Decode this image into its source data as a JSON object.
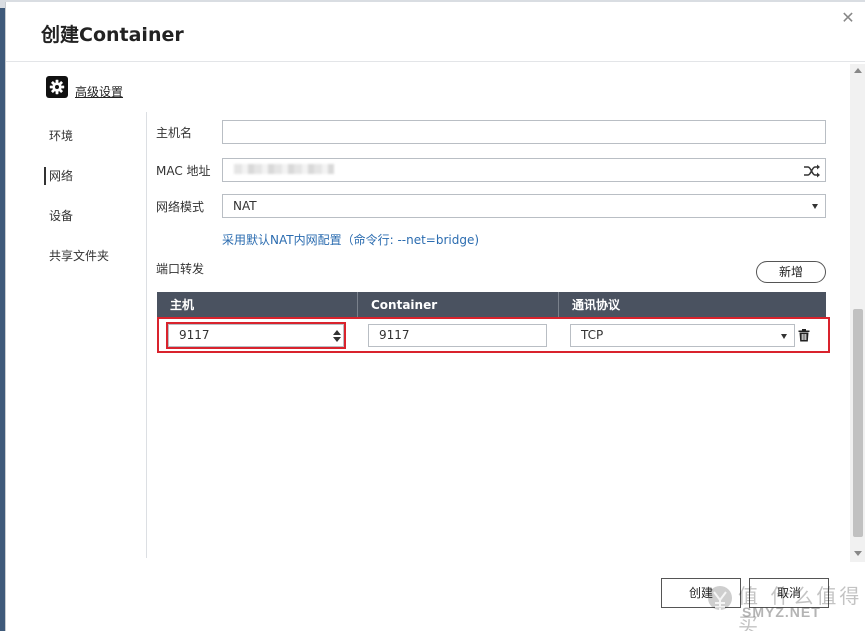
{
  "dialog": {
    "title": "创建Container",
    "close_symbol": "✕"
  },
  "advanced": {
    "icon": "gear-icon",
    "label": "高级设置"
  },
  "sidebar": {
    "items": [
      {
        "label": "环境",
        "active": false
      },
      {
        "label": "网络",
        "active": true
      },
      {
        "label": "设备",
        "active": false
      },
      {
        "label": "共享文件夹",
        "active": false
      }
    ]
  },
  "network": {
    "hostname": {
      "label": "主机名",
      "value": ""
    },
    "mac": {
      "label": "MAC 地址",
      "value": "",
      "icon": "shuffle-icon"
    },
    "mode": {
      "label": "网络模式",
      "value": "NAT"
    },
    "hint_link": "采用默认NAT内网配置（命令行: --net=bridge)",
    "port_forward_label": "端口转发",
    "add_button": "新增"
  },
  "port_table": {
    "columns": [
      "主机",
      "Container",
      "通讯协议"
    ],
    "rows": [
      {
        "host": "9117",
        "container": "9117",
        "protocol": "TCP"
      }
    ]
  },
  "footer": {
    "create_label": "创建",
    "cancel_label": "取消"
  },
  "watermark": {
    "text": "值 什么值得买",
    "site": "SMYZ.NET"
  },
  "colors": {
    "table_header": "#4a5260",
    "highlight": "#d9232d",
    "link": "#2b6cb0"
  }
}
